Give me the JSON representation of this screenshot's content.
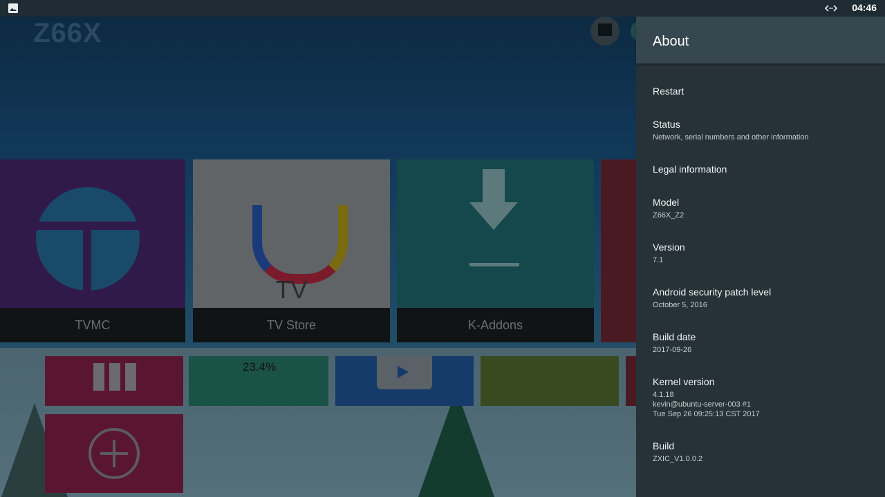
{
  "status_bar": {
    "left_icon": "image-icon",
    "network_icon": "ethernet-arrows-icon",
    "time": "04:46"
  },
  "launcher": {
    "brand": "Z66X",
    "tiles": [
      {
        "label": "TVMC"
      },
      {
        "label": "TV Store",
        "art_text": "TV"
      },
      {
        "label": "K-Addons"
      }
    ],
    "small_tiles": [
      {
        "icon": "apps-grid-icon"
      },
      {
        "icon": "cleaner-icon",
        "text": "23.4%"
      },
      {
        "icon": "play-icon"
      },
      {
        "icon": "folder-android-icon"
      },
      {
        "icon": "add-icon"
      }
    ]
  },
  "about": {
    "title": "About",
    "items": [
      {
        "title": "Restart",
        "summary": ""
      },
      {
        "title": "Status",
        "summary": "Network, serial numbers and other information"
      },
      {
        "title": "Legal information",
        "summary": ""
      },
      {
        "title": "Model",
        "summary": "Z66X_Z2"
      },
      {
        "title": "Version",
        "summary": "7.1"
      },
      {
        "title": "Android security patch level",
        "summary": "October 5, 2016"
      },
      {
        "title": "Build date",
        "summary": "2017-09-26"
      },
      {
        "title": "Kernel version",
        "summary": "4.1.18\nkevin@ubuntu-server-003 #1\nTue Sep 26 09:25:13 CST 2017"
      },
      {
        "title": "Build",
        "summary": "ZXIC_V1.0.0.2"
      }
    ]
  }
}
